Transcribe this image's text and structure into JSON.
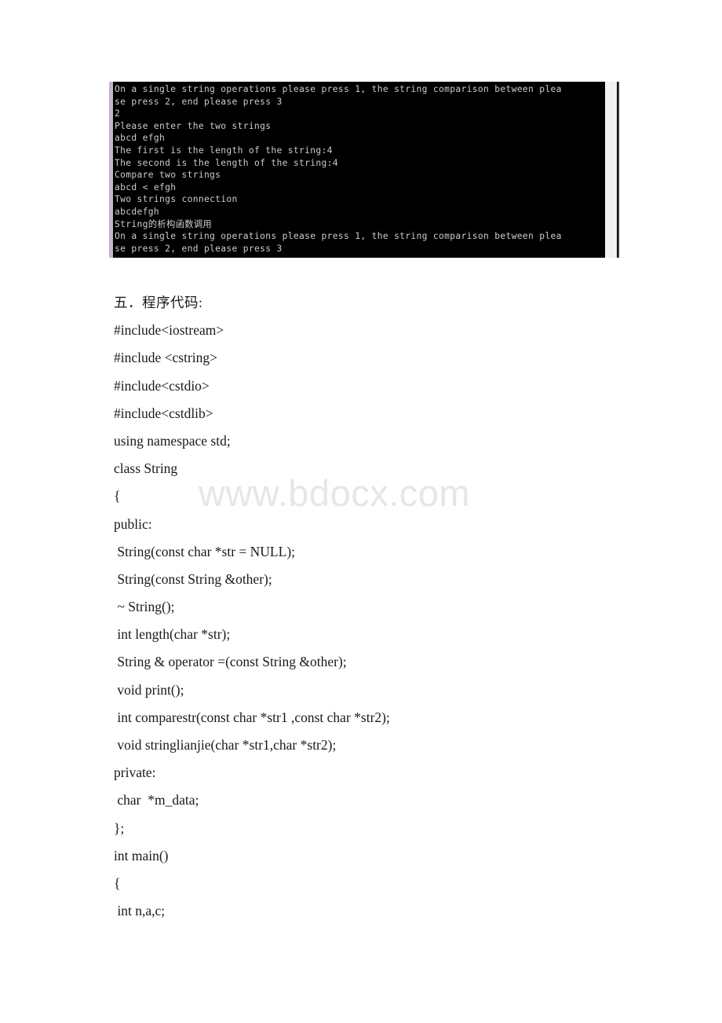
{
  "console": {
    "title": "command-prompt-output",
    "lines": [
      {
        "text": "On a single string operations please press 1, the string comparison between plea",
        "cjk": false
      },
      {
        "text": "se press 2, end please press 3",
        "cjk": false
      },
      {
        "text": "2",
        "cjk": false
      },
      {
        "text": "Please enter the two strings",
        "cjk": false
      },
      {
        "text": "abcd efgh",
        "cjk": false
      },
      {
        "text": "The first is the length of the string:4",
        "cjk": false
      },
      {
        "text": "The second is the length of the string:4",
        "cjk": false
      },
      {
        "text": "Compare two strings",
        "cjk": false
      },
      {
        "text": "abcd < efgh",
        "cjk": false
      },
      {
        "text": "Two strings connection",
        "cjk": false
      },
      {
        "text": "abcdefgh",
        "cjk": false
      },
      {
        "text": "String的析构函数调用",
        "cjk": true
      },
      {
        "text": "On a single string operations please press 1, the string comparison between plea",
        "cjk": false
      },
      {
        "text": "se press 2, end please press 3",
        "cjk": false
      }
    ],
    "background_color": "#000000",
    "text_color": "#cccccc",
    "left_edge_color": "#c3b3cd",
    "scrollbar_color": "#f1f1f1"
  },
  "watermark": {
    "text": "www.bdocx.com",
    "color": "#e6e6e6"
  },
  "document": {
    "heading": "五．程序代码:",
    "code_lines": [
      "#include<iostream>",
      "#include <cstring>",
      "#include<cstdio>",
      "#include<cstdlib>",
      "using namespace std;",
      "class String",
      "{",
      "public:",
      " String(const char *str = NULL);",
      " String(const String &other);",
      " ~ String();",
      " int length(char *str);",
      " String & operator =(const String &other);",
      " void print();",
      " int comparestr(const char *str1 ,const char *str2);",
      " void stringlianjie(char *str1,char *str2);",
      "private:",
      " char  *m_data;",
      "};",
      "int main()",
      "{",
      " int n,a,c;"
    ]
  }
}
